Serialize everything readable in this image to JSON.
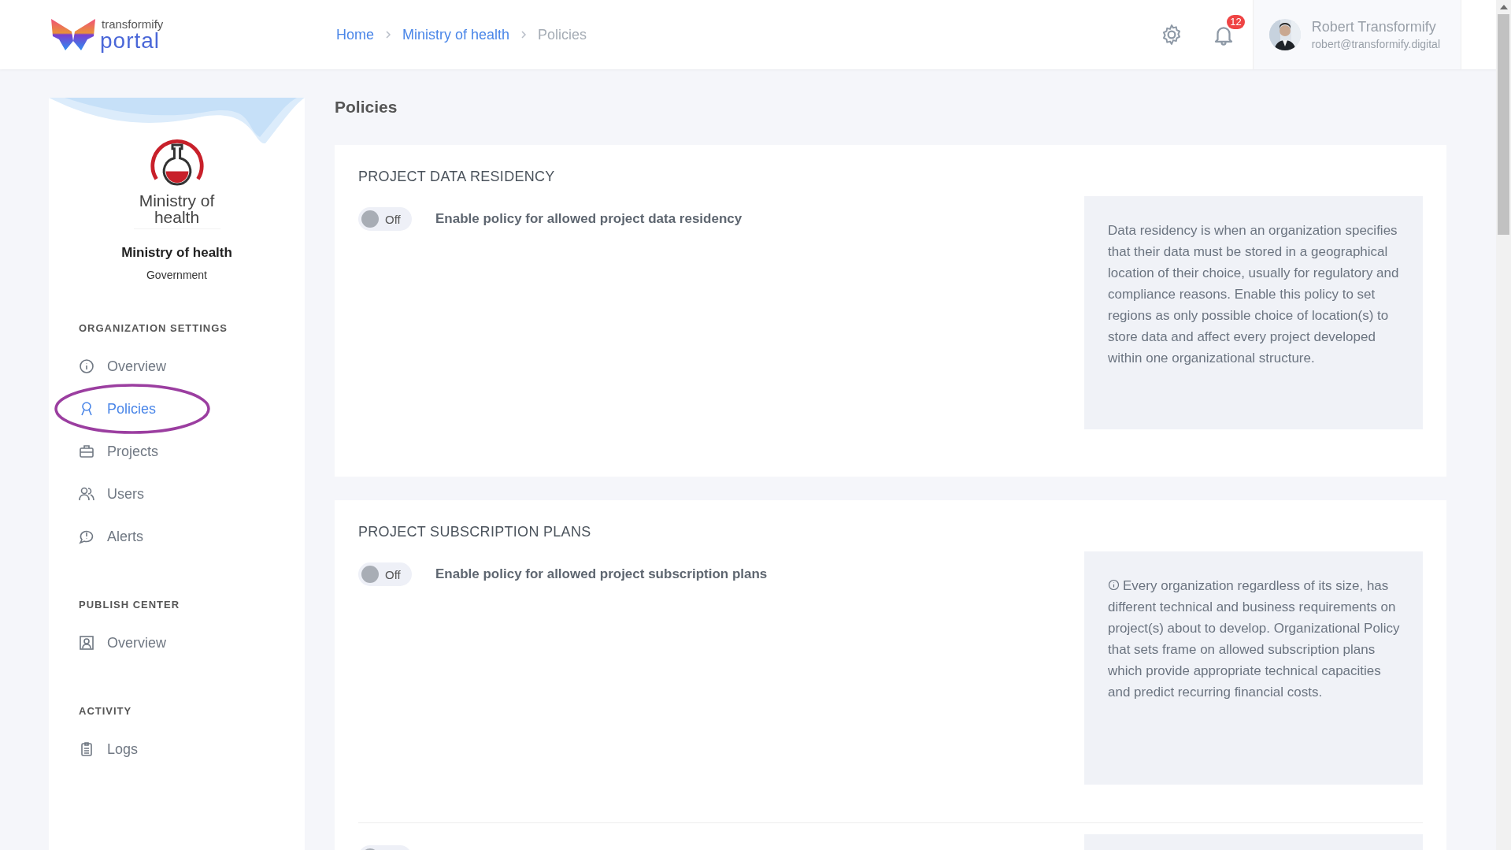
{
  "brand": {
    "small": "transformify",
    "large": "portal"
  },
  "breadcrumbs": [
    {
      "label": "Home",
      "current": false
    },
    {
      "label": "Ministry of health",
      "current": false
    },
    {
      "label": "Policies",
      "current": true
    }
  ],
  "notifications": {
    "count": "12"
  },
  "user": {
    "name": "Robert Transformify",
    "email": "robert@transformify.digital"
  },
  "organization": {
    "logo_text": "Ministry of health",
    "name": "Ministry of health",
    "type": "Government"
  },
  "sidebar": [
    {
      "heading": "ORGANIZATION SETTINGS",
      "items": [
        {
          "label": "Overview",
          "kind": "info",
          "selected": false,
          "circled": false
        },
        {
          "label": "Policies",
          "kind": "ribbon",
          "selected": true,
          "circled": true
        },
        {
          "label": "Projects",
          "kind": "briefcase",
          "selected": false,
          "circled": false
        },
        {
          "label": "Users",
          "kind": "users",
          "selected": false,
          "circled": false
        },
        {
          "label": "Alerts",
          "kind": "alert",
          "selected": false,
          "circled": false
        }
      ]
    },
    {
      "heading": "PUBLISH CENTER",
      "items": [
        {
          "label": "Overview",
          "kind": "portrait",
          "selected": false,
          "circled": false
        }
      ]
    },
    {
      "heading": "ACTIVITY",
      "items": [
        {
          "label": "Logs",
          "kind": "clipboard",
          "selected": false,
          "circled": false
        }
      ]
    }
  ],
  "page_title": "Policies",
  "policies": [
    {
      "title": "PROJECT DATA RESIDENCY",
      "rows": [
        {
          "on": false,
          "toggle_label": "Off",
          "label": "Enable policy for allowed project data residency",
          "info_icon": false,
          "description": "Data residency is when an organization specifies that their data must be stored in a geographical location of their choice, usually for regulatory and compliance reasons. Enable this policy to set regions as only possible choice of location(s) to store data and affect every project developed within one organizational structure."
        }
      ]
    },
    {
      "title": "PROJECT SUBSCRIPTION PLANS",
      "rows": [
        {
          "on": false,
          "toggle_label": "Off",
          "label": "Enable policy for allowed project subscription plans",
          "info_icon": true,
          "description": "Every organization regardless of its size, has different technical and business requirements on project(s) about to develop. Organizational Policy that sets frame on allowed subscription plans which provide appropriate technical capacities and predict recurring financial costs."
        },
        {
          "on": false
        }
      ]
    }
  ]
}
